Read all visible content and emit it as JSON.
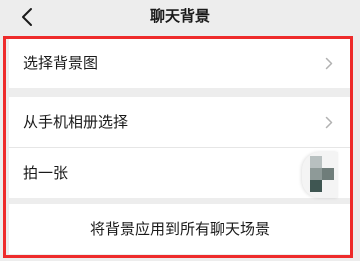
{
  "header": {
    "title": "聊天背景",
    "back_icon": "chevron-left-icon"
  },
  "groups": [
    {
      "items": [
        {
          "label": "选择背景图",
          "icon": "chevron-right-icon"
        }
      ]
    },
    {
      "items": [
        {
          "label": "从手机相册选择",
          "icon": "chevron-right-icon"
        },
        {
          "label": "拍一张"
        }
      ]
    },
    {
      "items": [
        {
          "label": "将背景应用到所有聊天场景"
        }
      ]
    }
  ],
  "colors": {
    "background": "#ededed",
    "card": "#ffffff",
    "highlight": "#ee2b2b",
    "text": "#1a1a1a",
    "chevron": "#b2b2b2"
  }
}
